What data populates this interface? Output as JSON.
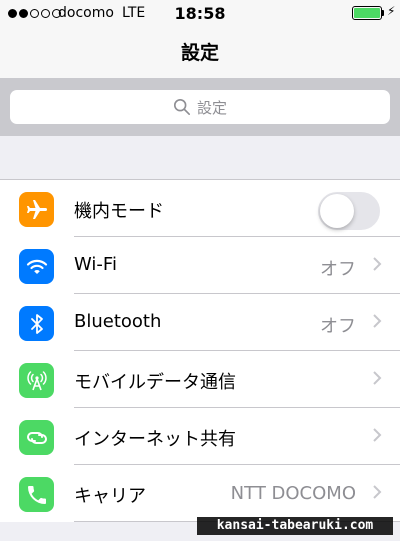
{
  "status": {
    "carrier": "docomo",
    "network": "LTE",
    "time": "18:58",
    "signal_bars_filled": 2,
    "signal_bars_total": 5,
    "battery_level": 1.0,
    "battery_color": "#4cd964"
  },
  "nav": {
    "title": "設定"
  },
  "search": {
    "placeholder": "設定"
  },
  "rows": [
    {
      "label": "機内モード",
      "icon": "airplane-icon",
      "color": "#ff9500",
      "control": "toggle",
      "toggle_on": false
    },
    {
      "label": "Wi-Fi",
      "icon": "wifi-icon",
      "color": "#007aff",
      "value": "オフ"
    },
    {
      "label": "Bluetooth",
      "icon": "bluetooth-icon",
      "color": "#007aff",
      "value": "オフ"
    },
    {
      "label": "モバイルデータ通信",
      "icon": "antenna-icon",
      "color": "#4cd964"
    },
    {
      "label": "インターネット共有",
      "icon": "hotspot-icon",
      "color": "#4cd964"
    },
    {
      "label": "キャリア",
      "icon": "phone-icon",
      "color": "#4cd964",
      "value": "NTT DOCOMO"
    }
  ],
  "watermark": "kansai-tabearuki.com"
}
